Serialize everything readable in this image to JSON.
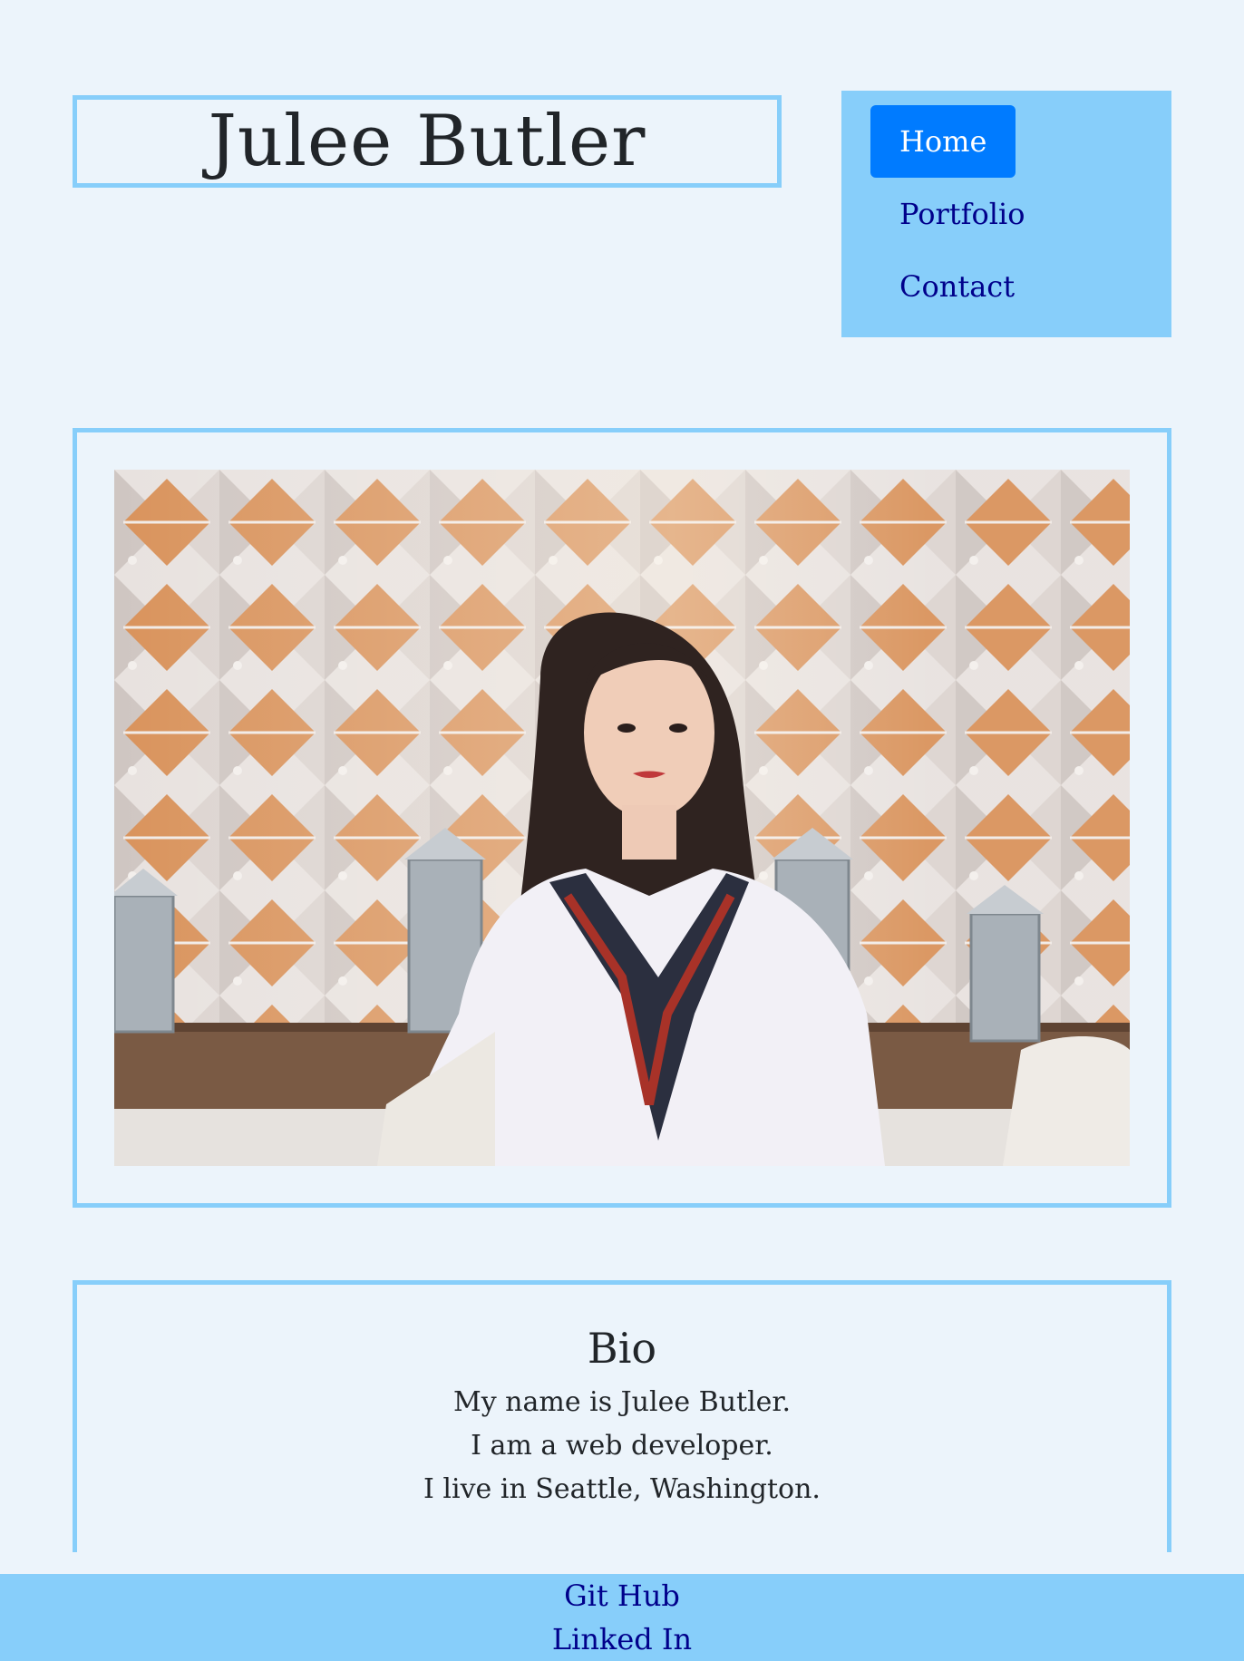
{
  "header": {
    "name": "Julee Butler"
  },
  "nav": {
    "items": [
      {
        "label": "Home",
        "active": true
      },
      {
        "label": "Portfolio",
        "active": false
      },
      {
        "label": "Contact",
        "active": false
      }
    ]
  },
  "bio": {
    "heading": "Bio",
    "lines": [
      "My name is Julee Butler.",
      "I am a web developer.",
      "I live in Seattle, Washington."
    ]
  },
  "footer": {
    "links": [
      "Git Hub",
      "Linked In"
    ]
  },
  "colors": {
    "page_background": "#ecf4fb",
    "accent_border": "#87cefa",
    "nav_active": "#007bff",
    "link": "#00008b"
  }
}
